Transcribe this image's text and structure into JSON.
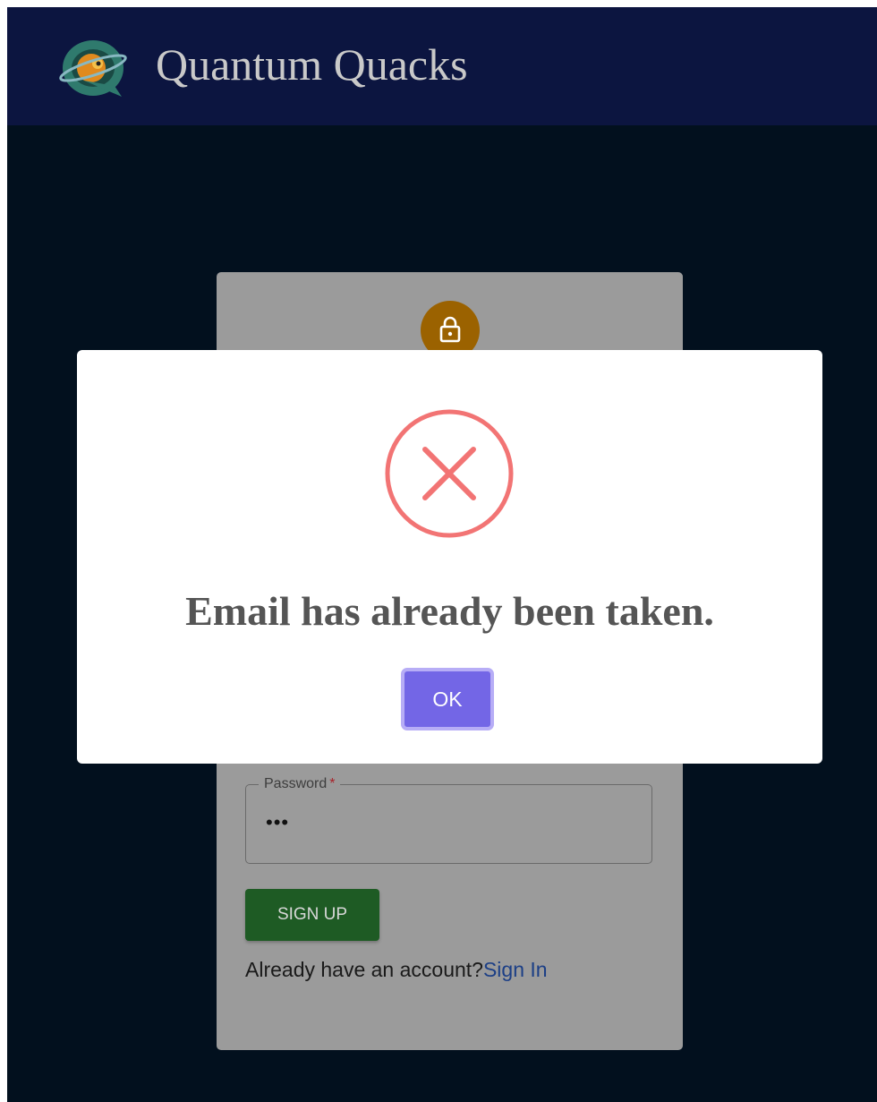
{
  "header": {
    "app_title": "Quantum Quacks",
    "logo_icon": "quantum-quacks-logo-icon"
  },
  "signup_form": {
    "lock_icon": "lock-icon",
    "password": {
      "label": "Password",
      "required_marker": "*",
      "value": "•••"
    },
    "signup_button_label": "SIGN UP",
    "signin_prompt": "Already have an account?",
    "signin_link_label": "Sign In"
  },
  "modal": {
    "icon": "error-x-icon",
    "message": "Email has already been taken.",
    "ok_label": "OK"
  },
  "colors": {
    "app_bar": "#0c1540",
    "page_background": "#02101e",
    "card": "#9b9b9b",
    "lock_avatar": "#9b6200",
    "signup_button": "#1e5b24",
    "signin_link": "#1c3f86",
    "error": "#f27474",
    "ok_button": "#7366e6",
    "ok_button_focus_ring": "#b7adf6"
  }
}
